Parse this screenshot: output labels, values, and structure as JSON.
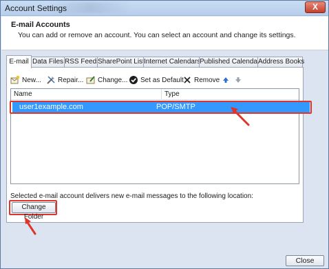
{
  "window": {
    "title": "Account Settings",
    "close_glyph": "X"
  },
  "header": {
    "title": "E-mail Accounts",
    "description": "You can add or remove an account. You can select an account and change its settings."
  },
  "tabs": [
    {
      "label": "E-mail",
      "active": true
    },
    {
      "label": "Data Files"
    },
    {
      "label": "RSS Feeds"
    },
    {
      "label": "SharePoint Lists"
    },
    {
      "label": "Internet Calendars"
    },
    {
      "label": "Published Calendars"
    },
    {
      "label": "Address Books"
    }
  ],
  "toolbar": {
    "new_label": "New...",
    "repair_label": "Repair...",
    "change_label": "Change...",
    "default_label": "Set as Default",
    "remove_label": "Remove"
  },
  "list": {
    "columns": [
      "Name",
      "Type"
    ],
    "rows": [
      {
        "name": "user1example.com",
        "type": "POP/SMTP",
        "selected": true
      }
    ]
  },
  "footer": {
    "note": "Selected e-mail account delivers new e-mail messages to the following location:",
    "change_folder_label": "Change Folder",
    "close_label": "Close"
  },
  "colors": {
    "selection": "#3399ff",
    "annotation": "#e0342b"
  },
  "icons": [
    "new-icon",
    "repair-icon",
    "change-icon",
    "set-default-icon",
    "remove-icon",
    "move-up-icon",
    "move-down-icon"
  ]
}
